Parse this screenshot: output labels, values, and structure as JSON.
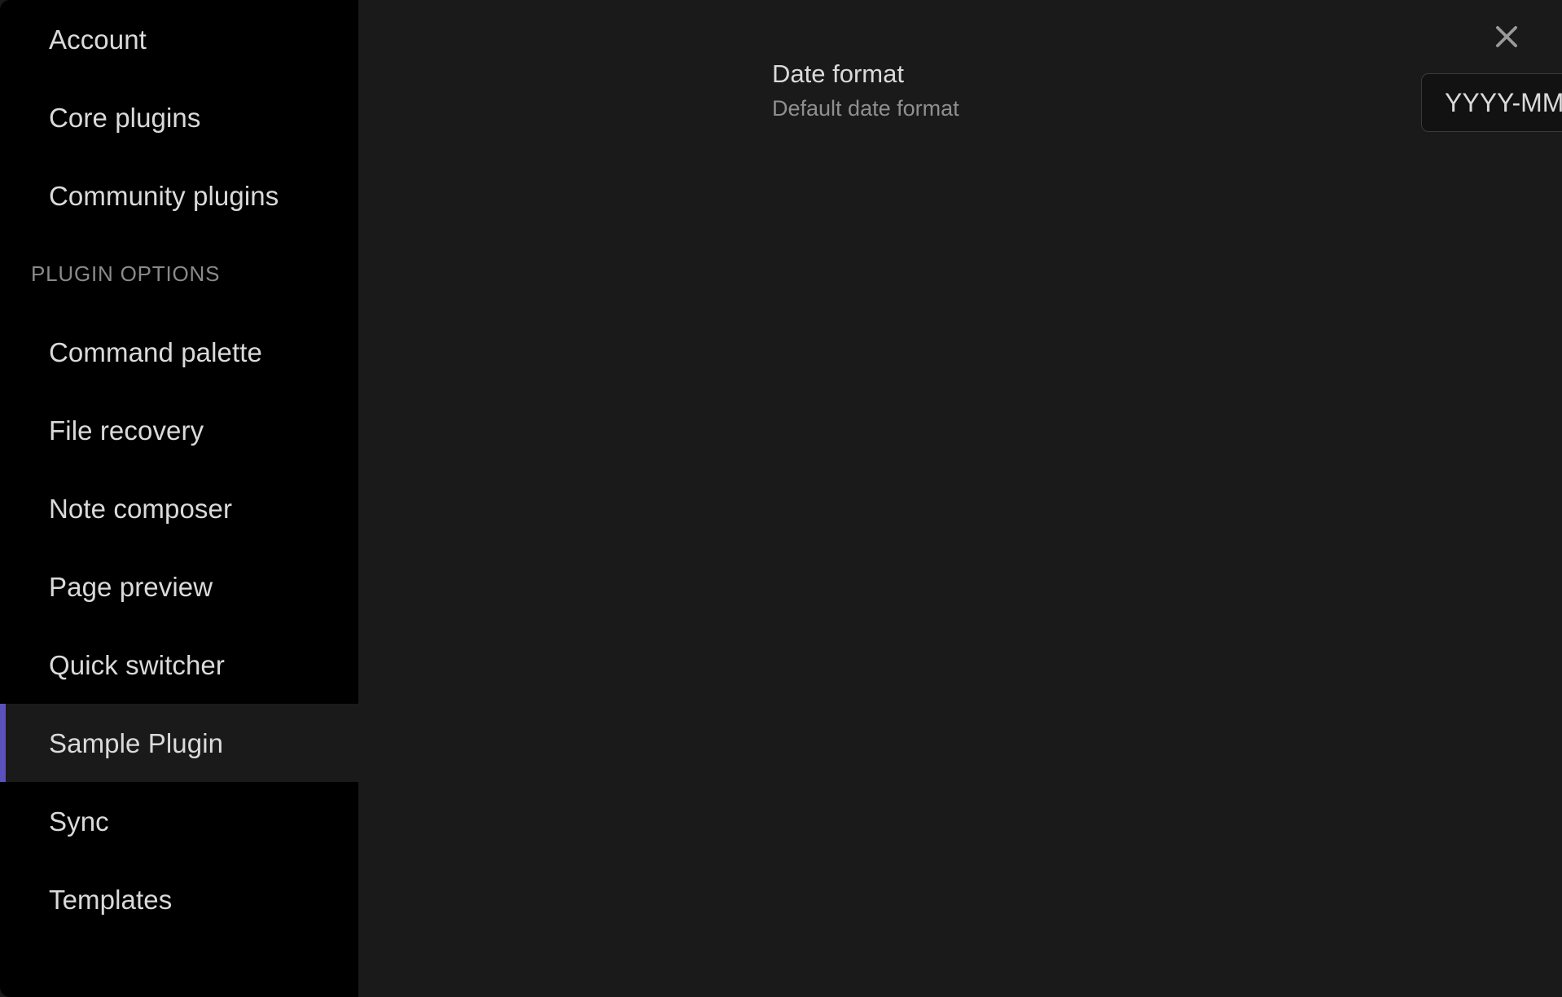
{
  "modal": {
    "close_icon": "close-icon",
    "close_label": "Close settings"
  },
  "sidebar": {
    "groups": [
      {
        "heading": null,
        "items": [
          {
            "label": "Account",
            "active": false
          },
          {
            "label": "Core plugins",
            "active": false
          },
          {
            "label": "Community plugins",
            "active": false
          }
        ]
      },
      {
        "heading": "Plugin options",
        "items": [
          {
            "label": "Command palette",
            "active": false
          },
          {
            "label": "File recovery",
            "active": false
          },
          {
            "label": "Note composer",
            "active": false
          },
          {
            "label": "Page preview",
            "active": false
          },
          {
            "label": "Quick switcher",
            "active": false
          },
          {
            "label": "Sample Plugin",
            "active": true
          },
          {
            "label": "Sync",
            "active": false
          },
          {
            "label": "Templates",
            "active": false
          }
        ]
      }
    ]
  },
  "main": {
    "settings": [
      {
        "name": "Date format",
        "description": "Default date format",
        "control": {
          "type": "text",
          "value": "YYYY-MM-DD",
          "placeholder": "YYYY-MM-DD"
        }
      }
    ]
  },
  "colors": {
    "sidebar_bg": "#000000",
    "panel_bg": "#1a1a1a",
    "active_accent": "#5b51bd",
    "active_item_bg": "#1a1a1a",
    "text_primary": "#dadada",
    "text_muted": "#8f8f8f",
    "heading_muted": "#8a8a8a",
    "input_bg": "#121212",
    "input_border": "#3b3b3b",
    "close_icon": "#9a9a9a"
  }
}
